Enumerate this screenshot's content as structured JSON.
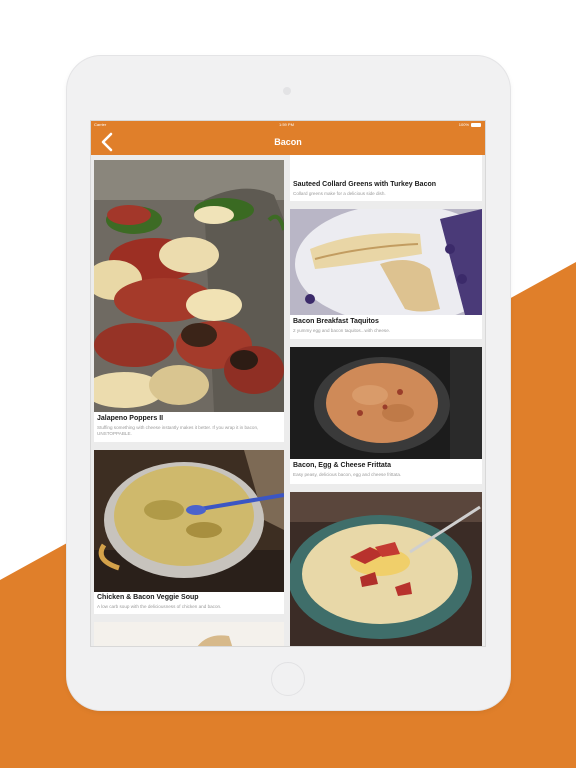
{
  "status": {
    "carrier": "Carrier",
    "time": "1:59 PM",
    "battery": "100%"
  },
  "navbar": {
    "title": "Bacon"
  },
  "recipes": [
    {
      "title": "Jalapeno Poppers II",
      "description": "Stuffing something with cheese instantly makes it better. If you wrap it in bacon, UNSTOPPABLE."
    },
    {
      "title": "Chicken & Bacon Veggie Soup",
      "description": "A low carb soup with the deliciousness of chicken and bacon."
    },
    {
      "title": "Sauteed Collard Greens with Turkey Bacon",
      "description": "Collard greens make for a delicious side dish."
    },
    {
      "title": "Bacon Breakfast Taquitos",
      "description": "2 yummy egg and bacon taquitos...with cheese."
    },
    {
      "title": "Bacon, Egg & Cheese Frittata",
      "description": "Easy peasy, delicious bacon, egg and cheese frittata."
    }
  ],
  "colors": {
    "accent": "#e07f2a",
    "background": "#ececec"
  }
}
